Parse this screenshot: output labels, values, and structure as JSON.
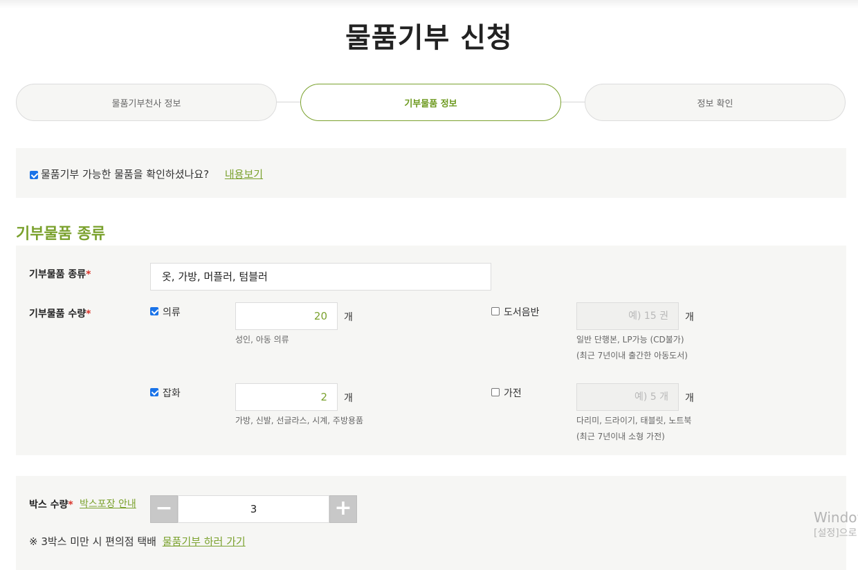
{
  "page": {
    "title": "물품기부 신청"
  },
  "steps": [
    {
      "label": "물품기부천사 정보",
      "active": false
    },
    {
      "label": "기부물품 정보",
      "active": true
    },
    {
      "label": "정보 확인",
      "active": false
    }
  ],
  "agree": {
    "checked": true,
    "text": "물품기부 가능한 물품을 확인하셨나요?",
    "link": "내용보기"
  },
  "section": {
    "title": "기부물품 종류"
  },
  "form": {
    "type_label": "기부물품 종류",
    "type_value": "옷, 가방, 머플러, 텀블러",
    "qty_label": "기부물품 수량",
    "required_mark": "*",
    "items": [
      {
        "label": "의류",
        "checked": true,
        "value": "20",
        "unit": "개",
        "hint": [
          "성인, 아동 의류"
        ]
      },
      {
        "label": "도서음반",
        "checked": false,
        "placeholder": "예) 15 권",
        "unit": "개",
        "hint": [
          "일반 단행본, LP가능 (CD불가)",
          "(최근 7년이내 출간한 아동도서)"
        ]
      },
      {
        "label": "잡화",
        "checked": true,
        "value": "2",
        "unit": "개",
        "hint": [
          "가방, 신발, 선글라스, 시계, 주방용품"
        ]
      },
      {
        "label": "가전",
        "checked": false,
        "placeholder": "예) 5 개",
        "unit": "개",
        "hint": [
          "다리미, 드라이기, 태블릿, 노트북",
          "(최근 7년이내 소형 가전)"
        ]
      }
    ]
  },
  "box": {
    "label": "박스 수량",
    "guide_link": "박스포장 안내",
    "minus": "−",
    "plus": "+",
    "value": "3",
    "note": "※ 3박스 미만 시 편의점 택배",
    "note_link": "물품기부 하러 가기"
  },
  "watermark": {
    "line1": "Window",
    "line2": "[설정]으로"
  },
  "colors": {
    "accent": "#7aa12d",
    "panel": "#f6f6f4",
    "required": "#d9342b"
  }
}
